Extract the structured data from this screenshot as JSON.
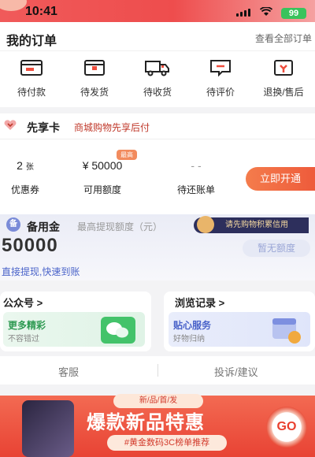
{
  "status_bar": {
    "time": "10:41",
    "battery": "99"
  },
  "orders": {
    "title": "我的订单",
    "view_all": "查看全部订单",
    "items": [
      {
        "label": "待付款",
        "icon": "wallet-icon"
      },
      {
        "label": "待发货",
        "icon": "box-icon"
      },
      {
        "label": "待收货",
        "icon": "truck-icon"
      },
      {
        "label": "待评价",
        "icon": "comment-icon"
      },
      {
        "label": "退换/售后",
        "icon": "return-icon"
      }
    ]
  },
  "vip_card": {
    "title": "先享卡",
    "subtitle": "商城购物先享后付",
    "coupons_value": "2",
    "coupons_unit": "张",
    "coupons_label": "优惠券",
    "credit_value": "¥ 50000",
    "credit_badge": "最高",
    "credit_label": "可用额度",
    "bill_value": "- -",
    "bill_label": "待还账单",
    "open_button": "立即开通"
  },
  "reserve_fund": {
    "icon_glyph": "备",
    "title": "备用金",
    "subtitle": "最高提现额度（元）",
    "tag": "请先购物积累信用",
    "amount": "50000",
    "no_limit": "暂无额度",
    "link": "直接提现,快速到账"
  },
  "official_account": {
    "title": "公众号 >",
    "line1": "更多精彩",
    "line2": "不容错过"
  },
  "history": {
    "title": "浏览记录 >",
    "line1": "贴心服务",
    "line2": "好物归纳"
  },
  "footer_links": {
    "service": "客服",
    "complaint": "投诉/建议"
  },
  "banner": {
    "ribbon": "新/品/首/发",
    "headline": "爆款新品特惠",
    "sub": "#黄金数码3C榜单推荐",
    "go": "GO"
  },
  "colors": {
    "accent": "#ee5b3b",
    "link": "#4a63c9",
    "vip_text": "#c0392b"
  }
}
